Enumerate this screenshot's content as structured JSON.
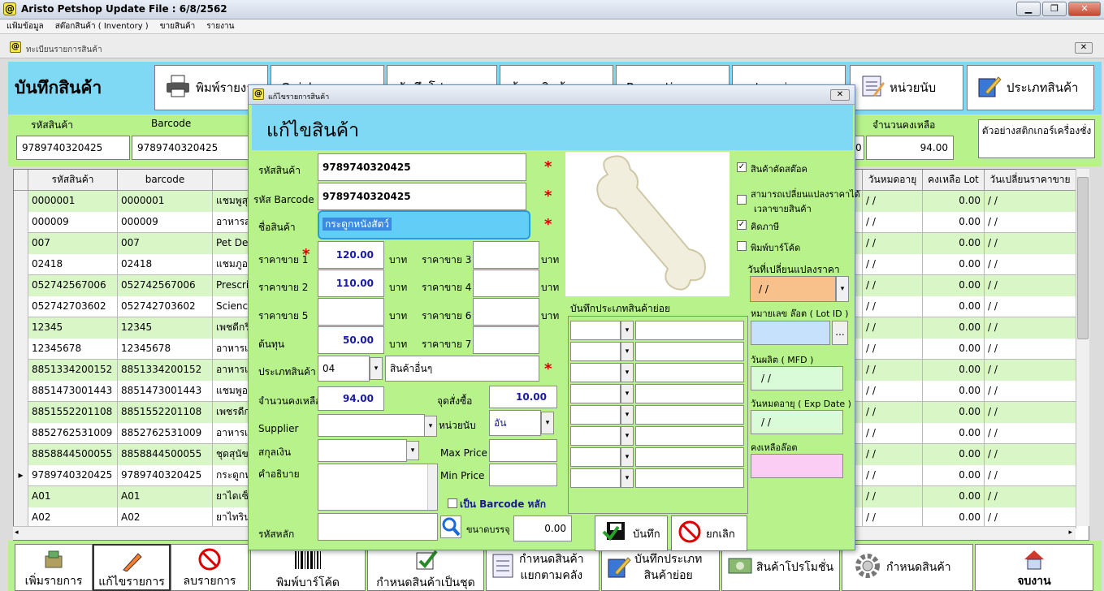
{
  "window": {
    "title": "Aristo Petshop  Update File : 6/8/2562",
    "min": "▁",
    "max": "❐",
    "close": "✕"
  },
  "menu": [
    "แฟ้มข้อมูล",
    "สต๊อกสินค้า ( Inventory )",
    "ขายสินค้า",
    "รายงาน"
  ],
  "mdi": {
    "title": "ทะเบียนรายการสินค้า",
    "close": "✕"
  },
  "header": {
    "title": "บันทึกสินค้า",
    "buttons": [
      "พิมพ์รายงาน",
      "Quick",
      "บันทึกโปร",
      "ค้นหาสินค้า",
      "Promotion",
      "แปลงหน่วย",
      "หน่วยนับ",
      "ประเภทสินค้า"
    ]
  },
  "fields": {
    "code_label": "รหัสสินค้า",
    "code_value": "9789740320425",
    "barcode_label": "Barcode",
    "barcode_value": "9789740320425",
    "stock_label": "จำนวนคงเหลือ",
    "stock_value": "94.00",
    "stock_prev": "0",
    "sticker_label": "ตัวอย่างสติกเกอร์เครื่องชั่ง"
  },
  "grid": {
    "columns": [
      "",
      "รหัสสินค้า",
      "barcode",
      "",
      "วันหมดอายุ",
      "คงเหลือ Lot",
      "วันเปลี่ยนราคาขาย"
    ],
    "rows": [
      {
        "marker": "",
        "code": "0000001",
        "barcode": "0000001",
        "name": "แชมพูสุ",
        "exp": "/ /",
        "lot": "0.00",
        "chg": "/ /"
      },
      {
        "marker": "",
        "code": "000009",
        "barcode": "000009",
        "name": "อาหารสุ",
        "exp": "/ /",
        "lot": "0.00",
        "chg": "/ /"
      },
      {
        "marker": "",
        "code": "007",
        "barcode": "007",
        "name": "Pet De",
        "exp": "/ /",
        "lot": "0.00",
        "chg": "/ /"
      },
      {
        "marker": "",
        "code": "02418",
        "barcode": "02418",
        "name": "แชมภูอ",
        "exp": "/ /",
        "lot": "0.00",
        "chg": "/ /"
      },
      {
        "marker": "",
        "code": "052742567006",
        "barcode": "052742567006",
        "name": "Prescri",
        "exp": "/ /",
        "lot": "0.00",
        "chg": "/ /"
      },
      {
        "marker": "",
        "code": "052742703602",
        "barcode": "052742703602",
        "name": "Science",
        "exp": "/ /",
        "lot": "0.00",
        "chg": "/ /"
      },
      {
        "marker": "",
        "code": "12345",
        "barcode": "12345",
        "name": "เพชดีกรี",
        "exp": "/ /",
        "lot": "0.00",
        "chg": "/ /"
      },
      {
        "marker": "",
        "code": "12345678",
        "barcode": "12345678",
        "name": "อาหารแ",
        "exp": "/ /",
        "lot": "0.00",
        "chg": "/ /"
      },
      {
        "marker": "",
        "code": "8851334200152",
        "barcode": "8851334200152",
        "name": "อาหารแ",
        "exp": "/ /",
        "lot": "0.00",
        "chg": "/ /"
      },
      {
        "marker": "",
        "code": "8851473001443",
        "barcode": "8851473001443",
        "name": "แชมพูอ",
        "exp": "/ /",
        "lot": "0.00",
        "chg": "/ /"
      },
      {
        "marker": "",
        "code": "8851552201108",
        "barcode": "8851552201108",
        "name": "เพชรดีก",
        "exp": "/ /",
        "lot": "0.00",
        "chg": "/ /"
      },
      {
        "marker": "",
        "code": "8852762531009",
        "barcode": "8852762531009",
        "name": "อาหารเ",
        "exp": "/ /",
        "lot": "0.00",
        "chg": "/ /"
      },
      {
        "marker": "",
        "code": "8858844500055",
        "barcode": "8858844500055",
        "name": "ชุดสุนัข",
        "exp": "/ /",
        "lot": "0.00",
        "chg": "/ /"
      },
      {
        "marker": "▸",
        "code": "9789740320425",
        "barcode": "9789740320425",
        "name": "กระดูกห",
        "exp": "/ /",
        "lot": "0.00",
        "chg": "/ /"
      },
      {
        "marker": "",
        "code": "A01",
        "barcode": "A01",
        "name": "ยาไดเซ็",
        "exp": "/ /",
        "lot": "0.00",
        "chg": "/ /"
      },
      {
        "marker": "",
        "code": "A02",
        "barcode": "A02",
        "name": "ยาไทริน",
        "exp": "/ /",
        "lot": "0.00",
        "chg": "/ /"
      }
    ]
  },
  "bottom": {
    "add": "เพิ่มรายการ",
    "edit": "แก้ไขรายการ",
    "delete": "ลบรายการ",
    "print_barcode": "พิมพ์บาร์โค้ด",
    "set_group": "กำหนดสินค้าเป็นชุด",
    "split_warehouse": [
      "กำหนดสินค้า",
      "แยกตามคลัง"
    ],
    "subtype": [
      "บันทึกประเภท",
      "สินค้าย่อย"
    ],
    "promo": "สินค้าโปรโมชั่น",
    "settings": "กำหนดสินค้า",
    "exit": "จบงาน"
  },
  "dialog": {
    "caption": "แก้ไขรายการสินค้า",
    "title": "แก้ไขสินค้า",
    "close": "✕",
    "code_label": "รหัสสินค้า",
    "code": "9789740320425",
    "barcode_label": "รหัส Barcode",
    "barcode": "9789740320425",
    "name_label": "ชื่อสินค้า",
    "name": "กระดูกหนังสัตว์",
    "price1_label": "ราคาขาย 1",
    "price1": "120.00",
    "price2_label": "ราคาขาย 2",
    "price2": "110.00",
    "price3_label": "ราคาขาย 3",
    "price4_label": "ราคาขาย 4",
    "price5_label": "ราคาขาย 5",
    "price6_label": "ราคาขาย 6",
    "price7_label": "ราคาขาย 7",
    "cost_label": "ต้นทุน",
    "cost": "50.00",
    "baht": "บาท",
    "type_label": "ประเภทสินค้า",
    "type_code": "04",
    "type_name": "สินค้าอื่นๆ",
    "stock_label": "จำนวนคงเหลือ",
    "stock": "94.00",
    "reorder_label": "จุดสั่งซื้อ",
    "reorder": "10.00",
    "supplier_label": "Supplier",
    "unit_label": "หน่วยนับ",
    "unit": "อัน",
    "currency_label": "สกุลเงิน",
    "max_label": "Max Price",
    "min_label": "Min Price",
    "desc_label": "คำอธิบาย",
    "main_barcode_label": "เป็น Barcode หลัก",
    "main_code_label": "รหัสหลัก",
    "size_label": "ขนาดบรรจุ",
    "size": "0.00",
    "subtype_label": "บันทึกประเภทสินค้าย่อย",
    "cut_stock": "สินค้าตัดสต๊อค",
    "change_price": "สามารถเปลี่ยนแปลงราคาได้",
    "change_price2": "เวลาขายสินค้า",
    "vat": "คิดภาษี",
    "print_barcode": "พิมพ์บาร์โค้ด",
    "price_change_date_label": "วันที่เปลี่ยนแปลงราคา",
    "price_change_date": "/ /",
    "lot_label": "หมายเลข ล๊อต ( Lot ID )",
    "lot_btn": "...",
    "mfd_label": "วันผลิต ( MFD )",
    "mfd": "/ /",
    "exp_label": "วันหมดอายุ ( Exp Date )",
    "exp": "/ /",
    "lot_remain_label": "คงเหลือล๊อต",
    "save": "บันทึก",
    "cancel": "ยกเลิก",
    "star": "*",
    "dd": "▾"
  }
}
